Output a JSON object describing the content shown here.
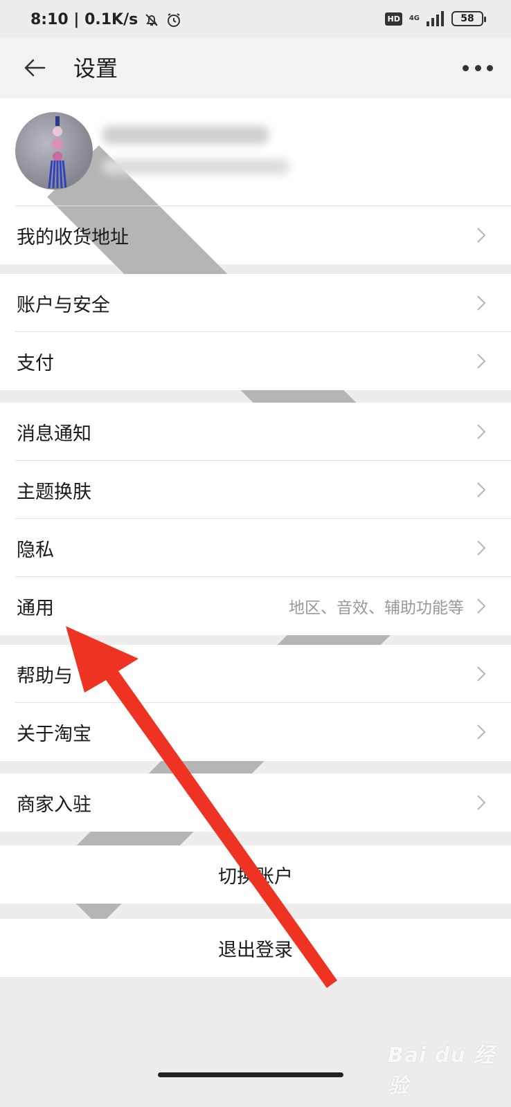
{
  "status_bar": {
    "time_speed": "8:10 | 0.1K/s",
    "hd": "HD",
    "network": "4G",
    "battery": "58"
  },
  "header": {
    "title": "设置"
  },
  "sections": {
    "address": "我的收货地址",
    "account_security": "账户与安全",
    "payment": "支付",
    "notifications": "消息通知",
    "theme": "主题换肤",
    "privacy": "隐私",
    "general": "通用",
    "general_hint": "地区、音效、辅助功能等",
    "help": "帮助与",
    "about": "关于淘宝",
    "merchant": "商家入驻",
    "switch_account": "切换账户",
    "logout": "退出登录"
  },
  "watermark": "Bai du 经验",
  "colors": {
    "arrow": "#ee3322",
    "background": "#ededed"
  }
}
